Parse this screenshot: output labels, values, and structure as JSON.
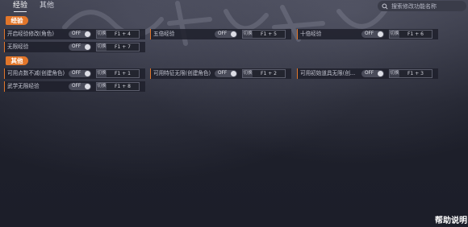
{
  "tabs": [
    {
      "label": "经验"
    },
    {
      "label": "其他"
    }
  ],
  "search": {
    "placeholder": "搜索修改功能名称",
    "icon": "search-icon"
  },
  "sections": [
    {
      "title": "经验",
      "options": [
        {
          "label": "开启经验修改(角色)",
          "toggle": "OFF",
          "action": "切换",
          "hotkey": "F1 + 4"
        },
        {
          "label": "五倍经验",
          "toggle": "OFF",
          "action": "切换",
          "hotkey": "F1 + 5"
        },
        {
          "label": "十倍经验",
          "toggle": "OFF",
          "action": "切换",
          "hotkey": "F1 + 6"
        },
        {
          "label": "无限经验",
          "toggle": "OFF",
          "action": "切换",
          "hotkey": "F1 + 7"
        }
      ]
    },
    {
      "title": "其他",
      "options": [
        {
          "label": "可用点数不减(创建角色)",
          "toggle": "OFF",
          "action": "切换",
          "hotkey": "F1 + 1"
        },
        {
          "label": "可用特征无限(创建角色)",
          "toggle": "OFF",
          "action": "切换",
          "hotkey": "F1 + 2"
        },
        {
          "label": "可用初始道具无限(创...",
          "toggle": "OFF",
          "action": "切换",
          "hotkey": "F1 + 3"
        },
        {
          "label": "武学无限经验",
          "toggle": "OFF",
          "action": "切换",
          "hotkey": "F1 + 8"
        }
      ]
    }
  ],
  "help": {
    "label": "帮助说明"
  },
  "colors": {
    "accent": "#e2762a",
    "background": "#1d1f2b",
    "panel": "#1e202c"
  }
}
